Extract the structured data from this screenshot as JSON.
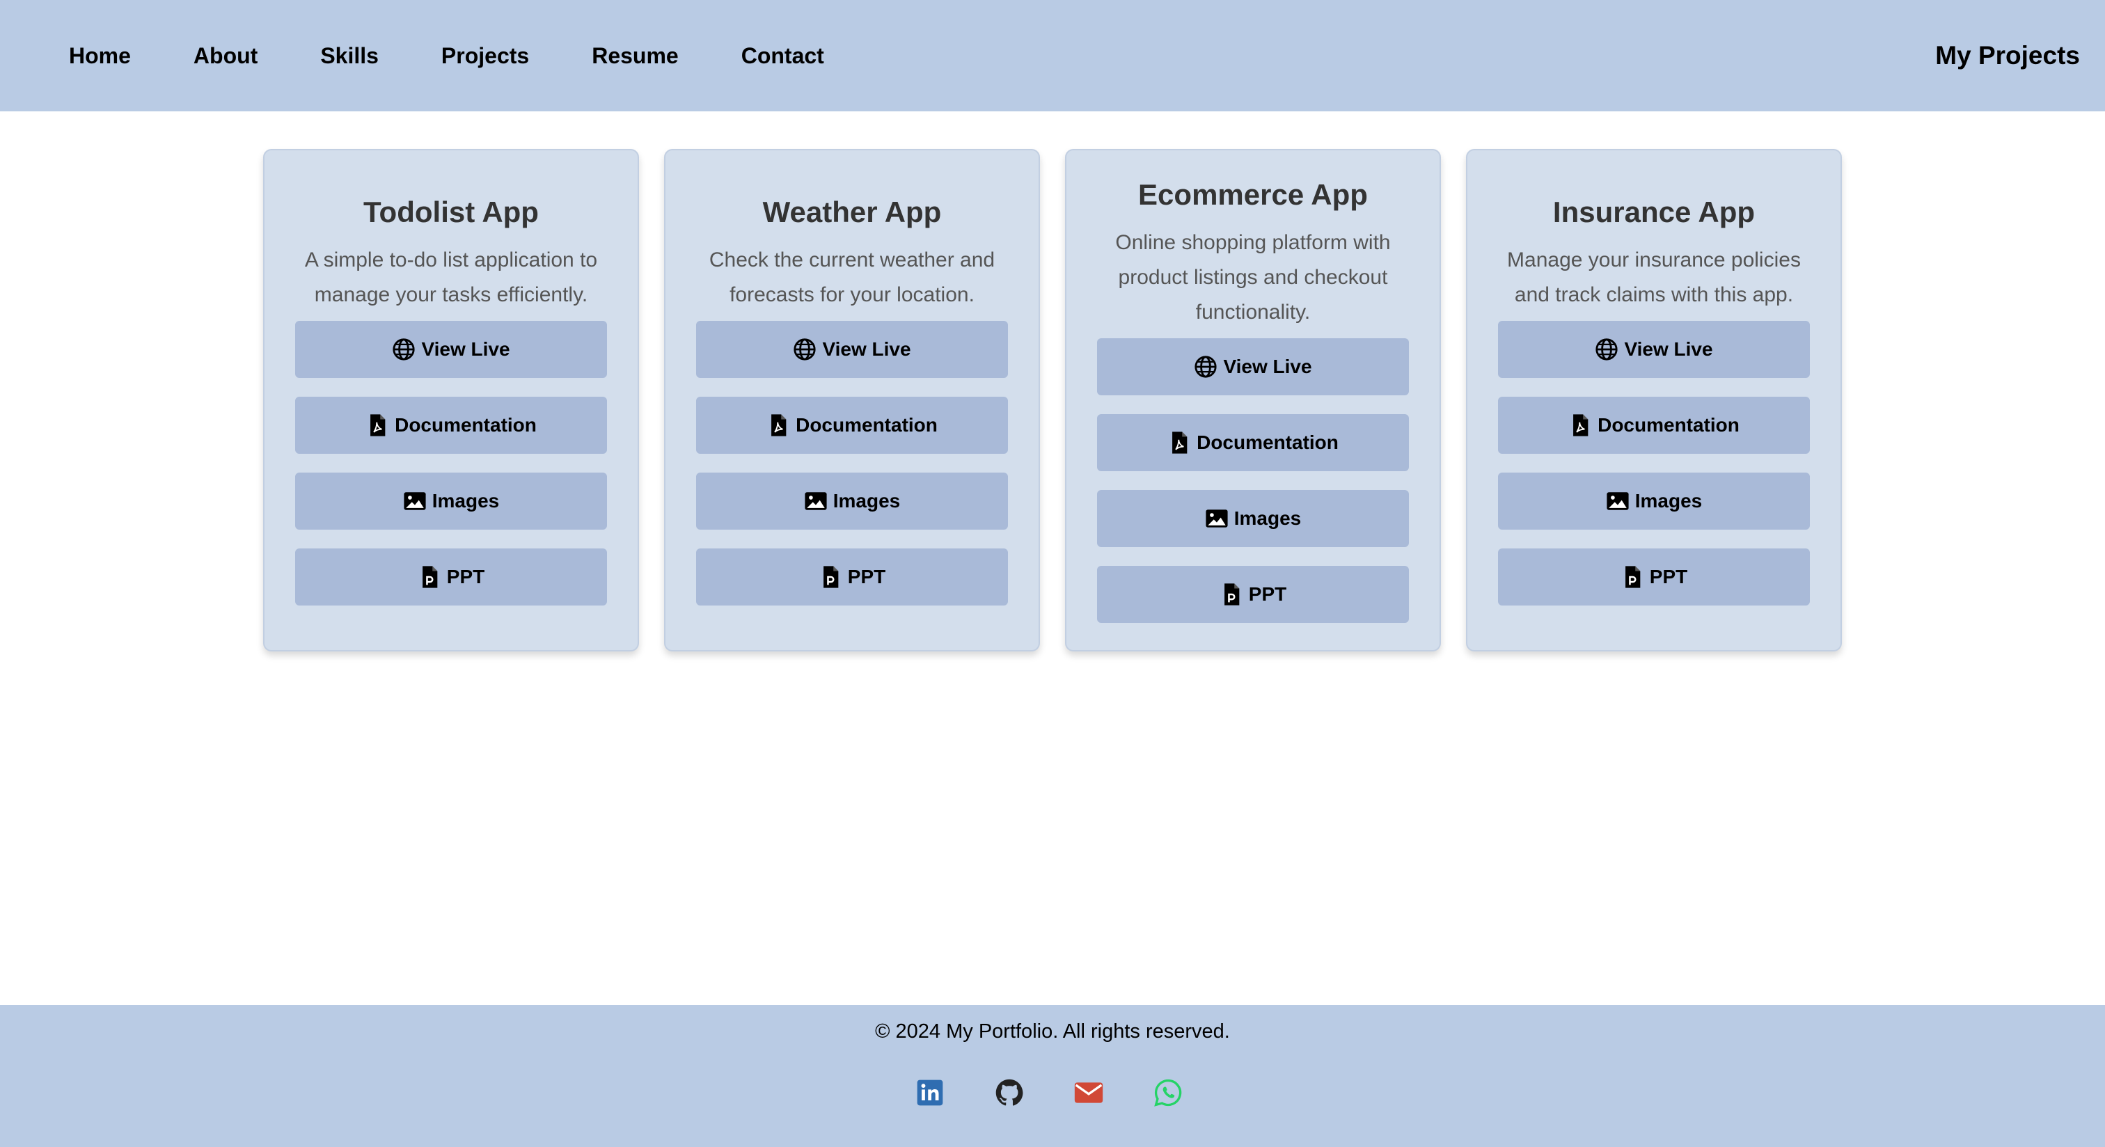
{
  "nav": {
    "links": [
      "Home",
      "About",
      "Skills",
      "Projects",
      "Resume",
      "Contact"
    ],
    "title": "My Projects"
  },
  "projects": [
    {
      "title": "Todolist App",
      "description": "A simple to-do list application to manage your tasks efficiently.",
      "buttons": [
        "View Live",
        "Documentation",
        "Images",
        "PPT"
      ]
    },
    {
      "title": "Weather App",
      "description": "Check the current weather and forecasts for your location.",
      "buttons": [
        "View Live",
        "Documentation",
        "Images",
        "PPT"
      ]
    },
    {
      "title": "Ecommerce App",
      "description": "Online shopping platform with product listings and checkout functionality.",
      "buttons": [
        "View Live",
        "Documentation",
        "Images",
        "PPT"
      ]
    },
    {
      "title": "Insurance App",
      "description": "Manage your insurance policies and track claims with this app.",
      "buttons": [
        "View Live",
        "Documentation",
        "Images",
        "PPT"
      ]
    }
  ],
  "button_icons": [
    "globe-icon",
    "pdf-file-icon",
    "image-icon",
    "ppt-file-icon"
  ],
  "footer": {
    "copyright": "© 2024 My Portfolio. All rights reserved.",
    "social_icons": [
      "linkedin-icon",
      "github-icon",
      "email-icon",
      "whatsapp-icon"
    ]
  },
  "colors": {
    "nav_bg": "#b9cbe4",
    "card_bg": "#d3deec",
    "button_bg": "#a9bad8",
    "linkedin": "#2f6db1",
    "github": "#222222",
    "email": "#d14836",
    "whatsapp": "#25d366"
  }
}
